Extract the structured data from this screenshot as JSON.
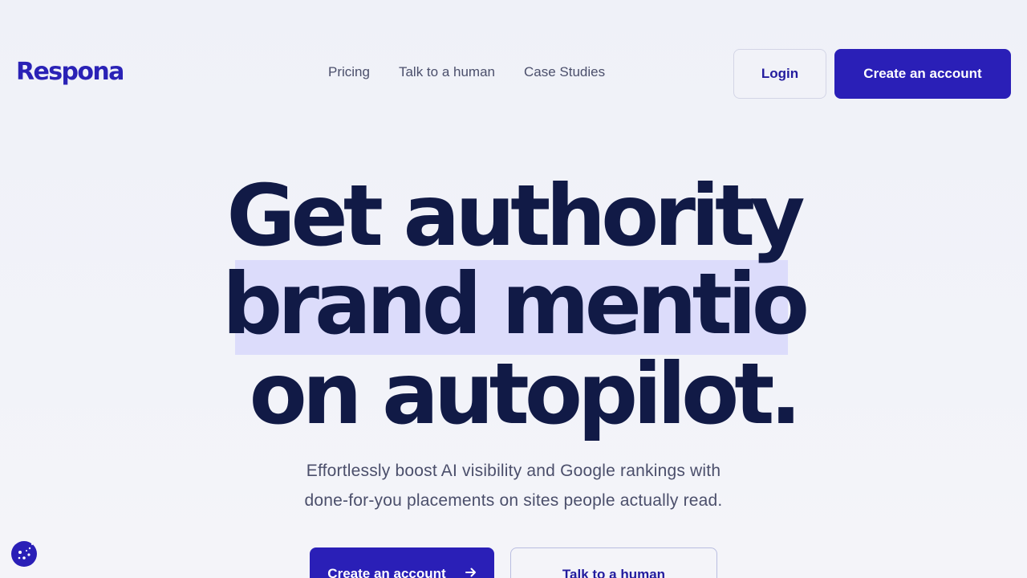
{
  "header": {
    "logo": "Respona",
    "nav": [
      {
        "label": "Pricing"
      },
      {
        "label": "Talk to a human"
      },
      {
        "label": "Case Studies"
      }
    ],
    "login_label": "Login",
    "create_account_label": "Create an account"
  },
  "hero": {
    "line1": "Get authority",
    "line2": "brand mentio",
    "line3": "on autopilot.",
    "subtitle_line1": "Effortlessly boost AI visibility and Google rankings with",
    "subtitle_line2": "done-for-you placements on sites people actually read.",
    "cta_primary_label": "Create an account",
    "cta_secondary_label": "Talk to a human"
  },
  "icons": {
    "arrow": "arrow-right-icon",
    "cookie": "cookie-icon"
  },
  "colors": {
    "brand": "#2a1fb7",
    "heading": "#111a46",
    "highlight": "#dcdcfb",
    "body_text": "#4b4f6b"
  }
}
